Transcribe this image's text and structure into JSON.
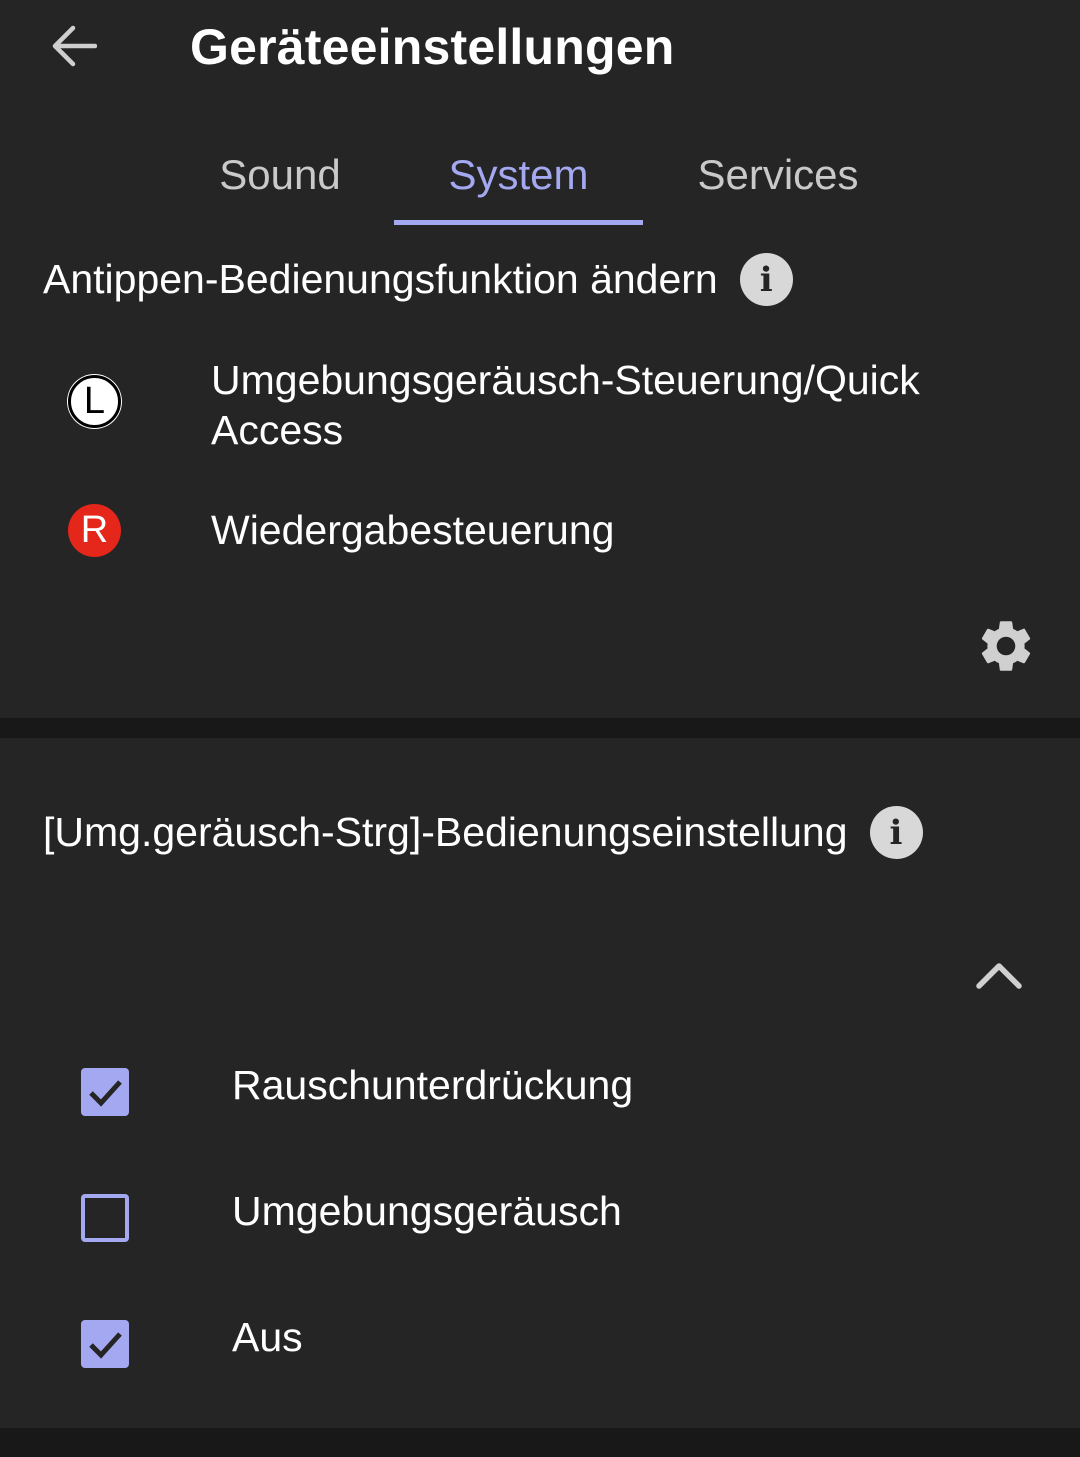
{
  "app_bar": {
    "title": "Geräteeinstellungen",
    "back_icon": "arrow-left-icon"
  },
  "tabs": [
    {
      "label": "Sound",
      "selected": false
    },
    {
      "label": "System",
      "selected": true
    },
    {
      "label": "Services",
      "selected": false
    }
  ],
  "tap_function": {
    "heading": "Antippen-Bedienungsfunktion ändern",
    "info_icon": "info-icon",
    "left": {
      "badge": "L",
      "value_line1": "Umgebungsgeräusch-Steuerung/Quick",
      "value_line2": "Access"
    },
    "right": {
      "badge": "R",
      "value": "Wiedergabesteuerung"
    },
    "settings_icon": "gear-icon"
  },
  "ambient_control": {
    "heading": "[Umg.geräusch-Strg]-Bedienungseinstellung",
    "info_icon": "info-icon",
    "collapse_icon": "chevron-up-icon",
    "options": [
      {
        "label": "Rauschunterdrückung",
        "checked": true
      },
      {
        "label": "Umgebungsgeräusch",
        "checked": false
      },
      {
        "label": "Aus",
        "checked": true
      }
    ]
  },
  "colors": {
    "accent": "#a3a8f0",
    "background": "#252525",
    "right_badge": "#e5271b"
  }
}
